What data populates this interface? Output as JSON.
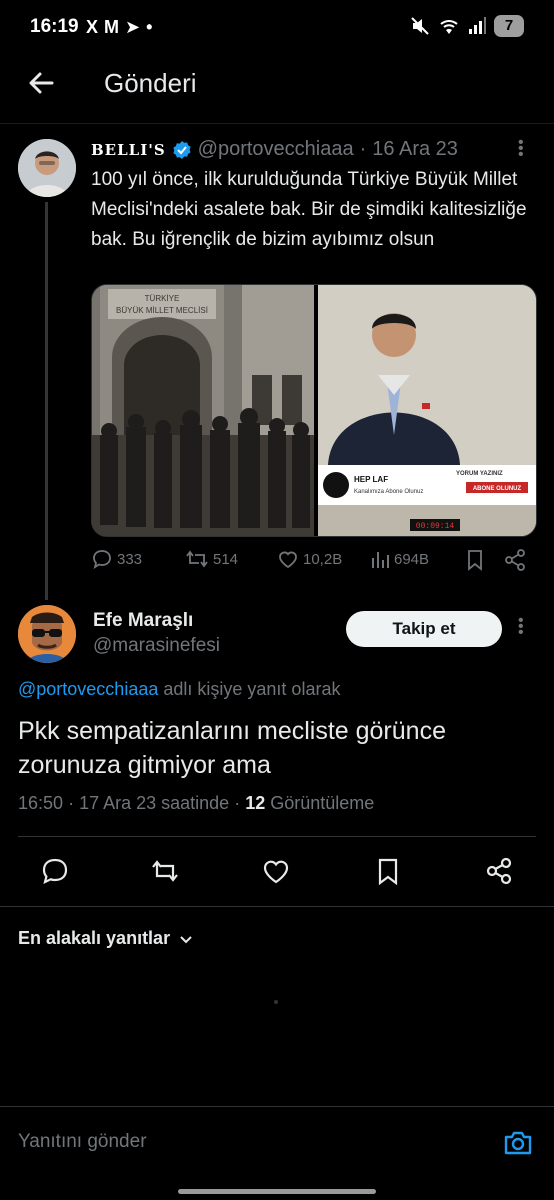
{
  "status_bar": {
    "time": "16:19",
    "notif_icons": [
      "X",
      "M",
      "➤",
      "•"
    ],
    "battery": "7"
  },
  "header": {
    "title": "Gönderi"
  },
  "tweet": {
    "author_name": "BELLI'S",
    "handle": "@portovecchiaaa",
    "separator": "·",
    "date": "16 Ara 23",
    "text": "100 yıl önce, ilk kurulduğunda Türkiye Büyük Millet Meclisi'ndeki asalete bak. Bir de şimdiki kalitesizliğe bak. Bu iğrençlik de bizim ayıbımız olsun",
    "media": {
      "left_sign_line1": "TÜRKİYE",
      "left_sign_line2": "BÜYÜK MİLLET MECLİSİ",
      "right_banner_brand": "HEP LAF",
      "right_banner_sub": "Kanalımıza Abone Olunuz",
      "right_banner_comment": "YORUM YAZINIZ",
      "right_banner_button": "ABONE OLUNUZ",
      "right_timer": "00:09:14"
    },
    "stats": {
      "replies": "333",
      "retweets": "514",
      "likes": "10,2B",
      "views": "694B"
    }
  },
  "reply": {
    "author_name": "Efe Maraşlı",
    "handle": "@marasinefesi",
    "follow_label": "Takip et",
    "reply_to_handle": "@portovecchiaaa",
    "reply_to_suffix": "adlı kişiye yanıt olarak",
    "text": "Pkk sempatizanlarını mecliste görünce zorunuza gitmiyor ama",
    "time": "16:50",
    "date_text": "17 Ara 23 saatinde",
    "views_count": "12",
    "views_label": "Görüntüleme"
  },
  "sort": {
    "label": "En alakalı yanıtlar"
  },
  "compose": {
    "placeholder": "Yanıtını gönder"
  },
  "colors": {
    "background": "#000000",
    "accent": "#1d9bf0",
    "muted": "#71767b",
    "text": "#e7e9ea"
  }
}
